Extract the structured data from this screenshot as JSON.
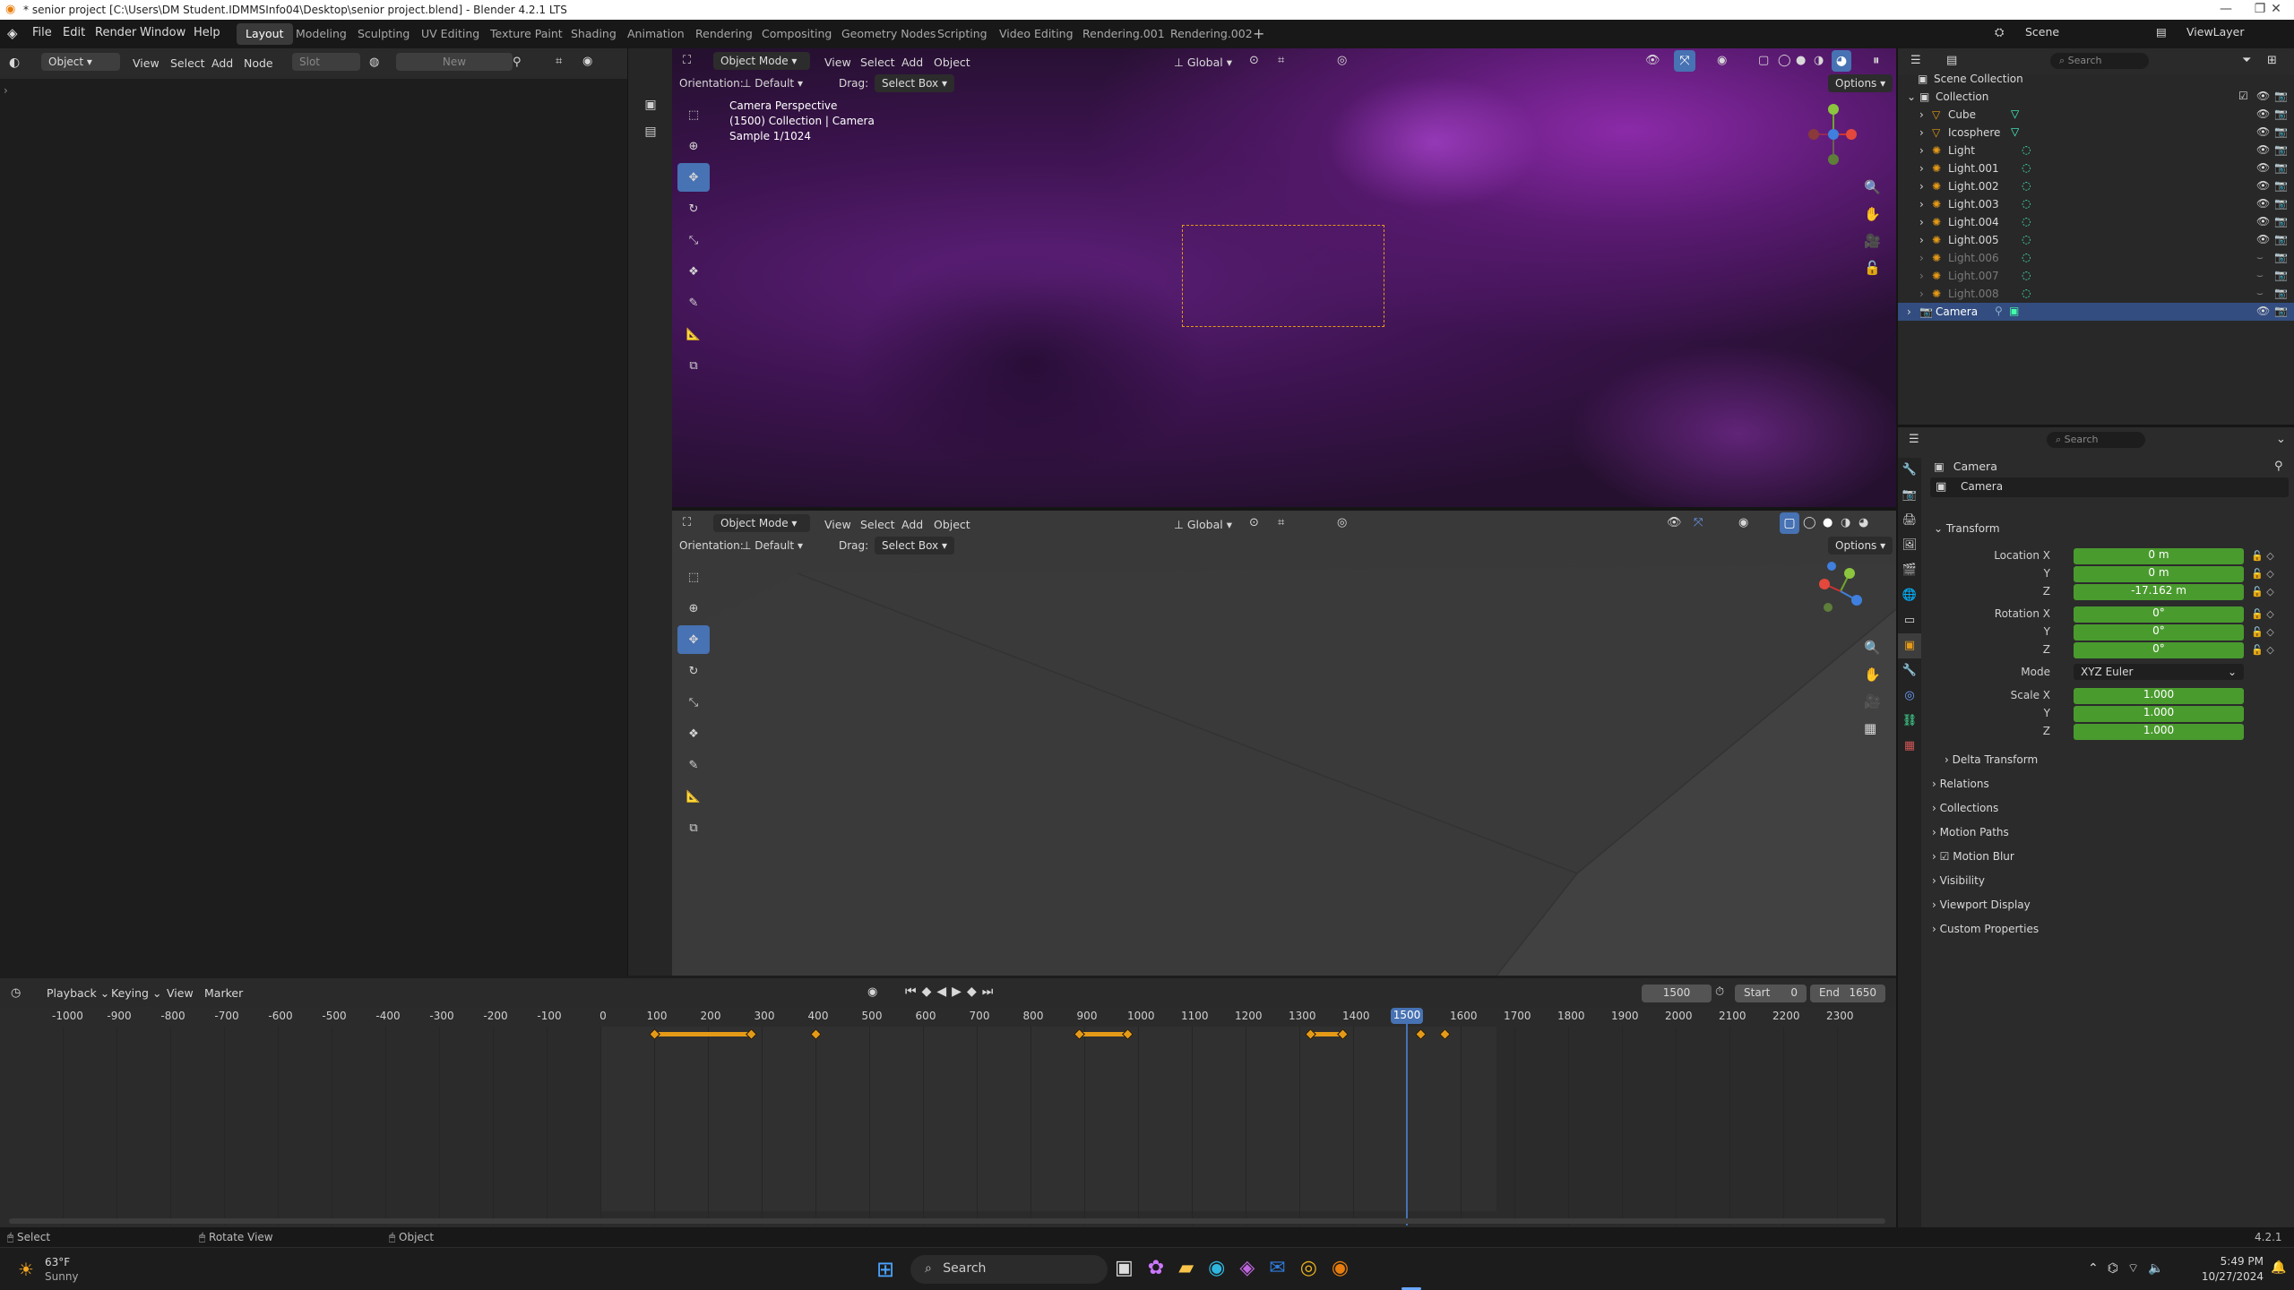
{
  "titlebar": {
    "title": "* senior project [C:\\Users\\DM Student.IDMMSInfo04\\Desktop\\senior project.blend] - Blender 4.2.1 LTS"
  },
  "menubar": {
    "items": [
      "File",
      "Edit",
      "Render",
      "Window",
      "Help"
    ],
    "workspaces": [
      "Layout",
      "Modeling",
      "Sculpting",
      "UV Editing",
      "Texture Paint",
      "Shading",
      "Animation",
      "Rendering",
      "Compositing",
      "Geometry Nodes",
      "Scripting",
      "Video Editing",
      "Rendering.001",
      "Rendering.002"
    ],
    "active_workspace": "Layout",
    "scene": "Scene",
    "view_layer": "ViewLayer"
  },
  "left_editor": {
    "object_label": "Object",
    "menus": [
      "View",
      "Select",
      "Add",
      "Node"
    ],
    "slot_label": "Slot",
    "new_label": "New"
  },
  "viewport_top": {
    "mode": "Object Mode",
    "menus": [
      "View",
      "Select",
      "Add",
      "Object"
    ],
    "orientation_label": "Orientation:",
    "orientation_value": "Default",
    "drag_label": "Drag:",
    "drag_value": "Select Box",
    "transform_orientation": "Global",
    "options_label": "Options",
    "overlay_line1": "Camera Perspective",
    "overlay_line2": "(1500) Collection | Camera",
    "overlay_line3": "Sample 1/1024"
  },
  "viewport_bottom": {
    "mode": "Object Mode",
    "menus": [
      "View",
      "Select",
      "Add",
      "Object"
    ],
    "orientation_label": "Orientation:",
    "orientation_value": "Default",
    "drag_label": "Drag:",
    "drag_value": "Select Box",
    "transform_orientation": "Global",
    "options_label": "Options"
  },
  "outliner": {
    "search_placeholder": "Search",
    "scene_collection": "Scene Collection",
    "collection": "Collection",
    "items": [
      {
        "name": "Cube",
        "faded": false
      },
      {
        "name": "Icosphere",
        "faded": false
      },
      {
        "name": "Light",
        "faded": false
      },
      {
        "name": "Light.001",
        "faded": false
      },
      {
        "name": "Light.002",
        "faded": false
      },
      {
        "name": "Light.003",
        "faded": false
      },
      {
        "name": "Light.004",
        "faded": false
      },
      {
        "name": "Light.005",
        "faded": false
      },
      {
        "name": "Light.006",
        "faded": true
      },
      {
        "name": "Light.007",
        "faded": true
      },
      {
        "name": "Light.008",
        "faded": true
      }
    ],
    "selected_item": "Camera"
  },
  "properties": {
    "search_placeholder": "Search",
    "object_name": "Camera",
    "data_name": "Camera",
    "transform_label": "Transform",
    "location_label": "Location X",
    "location": [
      "0 m",
      "0 m",
      "-17.162 m"
    ],
    "rotation_label": "Rotation X",
    "rotation": [
      "0°",
      "0°",
      "0°"
    ],
    "axis_y": "Y",
    "axis_z": "Z",
    "mode_label": "Mode",
    "mode_value": "XYZ Euler",
    "scale_label": "Scale X",
    "scale": [
      "1.000",
      "1.000",
      "1.000"
    ],
    "sections": [
      "Delta Transform",
      "Relations",
      "Collections",
      "Motion Paths",
      "Motion Blur",
      "Visibility",
      "Viewport Display",
      "Custom Properties"
    ]
  },
  "timeline": {
    "menus": [
      "Playback",
      "Keying",
      "View",
      "Marker"
    ],
    "current_frame": "1500",
    "start_label": "Start",
    "start_value": "0",
    "end_label": "End",
    "end_value": "1650",
    "ruler_labels": [
      "-1000",
      "-900",
      "-800",
      "-700",
      "-600",
      "-500",
      "-400",
      "-300",
      "-200",
      "-100",
      "0",
      "100",
      "200",
      "300",
      "400",
      "500",
      "600",
      "700",
      "800",
      "900",
      "1000",
      "1100",
      "1200",
      "1300",
      "1400",
      "1500",
      "1600",
      "1700",
      "1800",
      "1900",
      "2000",
      "2100",
      "2200",
      "2300"
    ],
    "keyframes": [
      100,
      280,
      400,
      890,
      980,
      1320,
      1380,
      1525,
      1570
    ]
  },
  "statusbar": {
    "select": "Select",
    "rotate": "Rotate View",
    "object": "Object",
    "version": "4.2.1"
  },
  "taskbar": {
    "weather_temp": "63°F",
    "weather_desc": "Sunny",
    "search_placeholder": "Search",
    "time": "5:49 PM",
    "date": "10/27/2024"
  },
  "colors": {
    "accent": "#4772b3",
    "keyframe": "#e59a17",
    "field_green": "#4a9b2e",
    "selected_row": "#334d80"
  }
}
